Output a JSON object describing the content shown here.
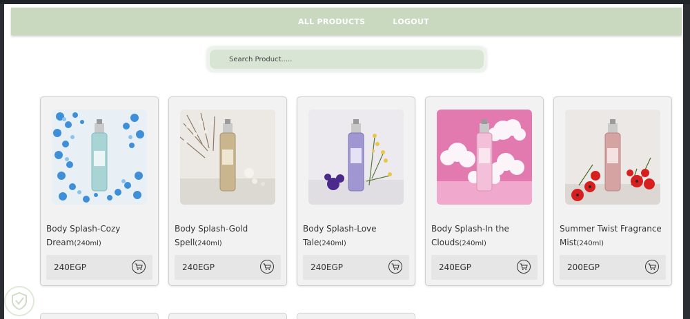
{
  "nav": {
    "all_products": "ALL PRODUCTS",
    "logout": "LOGOUT"
  },
  "search": {
    "placeholder": "Search Product....."
  },
  "colors": {
    "nav_bg": "#c9d9bf",
    "search_bg": "#d9e5d4",
    "card_bg": "#f2f2f2",
    "price_bg": "#e6e6e6"
  },
  "products": [
    {
      "title": "Body Splash-Cozy Dream",
      "size": "(240ml)",
      "price": "240EGP",
      "image": "blue-flowers-bottle"
    },
    {
      "title": "Body Splash-Gold Spell",
      "size": "(240ml)",
      "price": "240EGP",
      "image": "gold-bottle-branches"
    },
    {
      "title": "Body Splash-Love Tale",
      "size": "(240ml)",
      "price": "240EGP",
      "image": "purple-bottle-flowers"
    },
    {
      "title": "Body Splash-In the Clouds",
      "size": "(240ml)",
      "price": "240EGP",
      "image": "pink-bottle-clouds"
    },
    {
      "title": "Summer Twist Fragrance Mist",
      "size": "(240ml)",
      "price": "200EGP",
      "image": "rose-bottle-red-flowers"
    }
  ]
}
